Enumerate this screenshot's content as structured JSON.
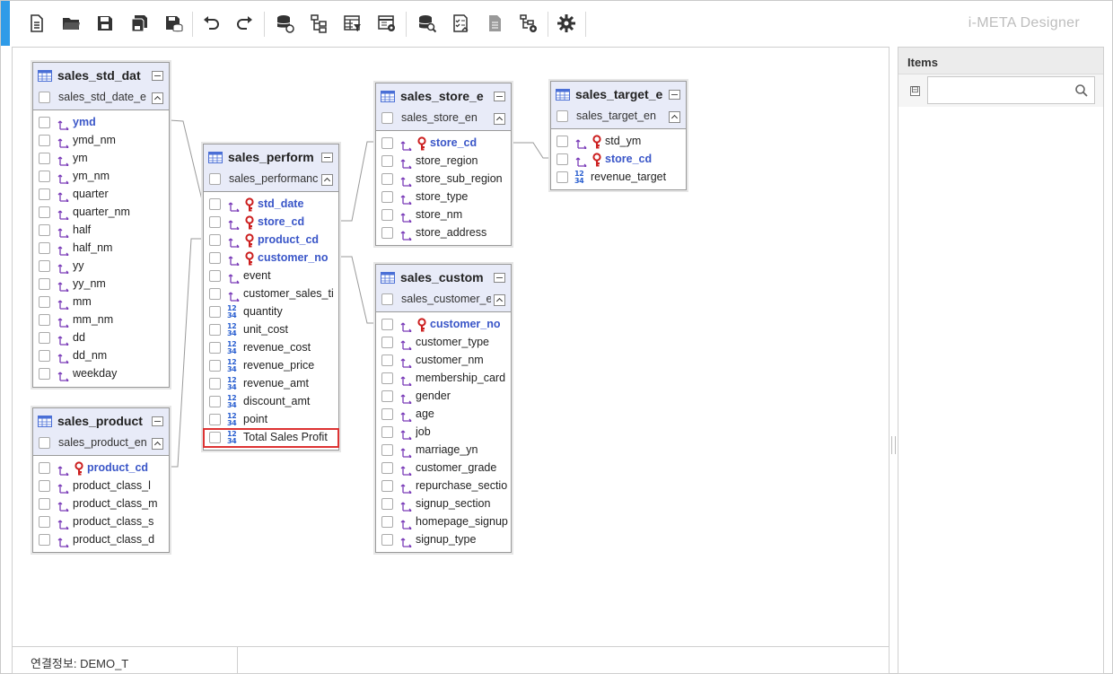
{
  "app": {
    "brand": "i-META Designer"
  },
  "toolbar": {
    "buttons": [
      {
        "name": "new-doc"
      },
      {
        "name": "open"
      },
      {
        "name": "save"
      },
      {
        "name": "save-all"
      },
      {
        "name": "save-db"
      },
      {
        "name": "undo"
      },
      {
        "name": "redo"
      },
      {
        "name": "db-link"
      },
      {
        "name": "tree"
      },
      {
        "name": "table-filter"
      },
      {
        "name": "table-settings"
      },
      {
        "name": "db-search"
      },
      {
        "name": "checklist"
      },
      {
        "name": "document"
      },
      {
        "name": "tree-settings"
      },
      {
        "name": "gear"
      }
    ]
  },
  "status": {
    "connection": "연결정보: DEMO_T"
  },
  "panel": {
    "title": "Items",
    "toggle": "⊟",
    "search_value": ""
  },
  "entities": {
    "std_date": {
      "title": "sales_std_dat",
      "sub": "sales_std_date_e",
      "fields": [
        {
          "name": "ymd",
          "kind": "dim",
          "pk": true
        },
        {
          "name": "ymd_nm",
          "kind": "dim"
        },
        {
          "name": "ym",
          "kind": "dim"
        },
        {
          "name": "ym_nm",
          "kind": "dim"
        },
        {
          "name": "quarter",
          "kind": "dim"
        },
        {
          "name": "quarter_nm",
          "kind": "dim"
        },
        {
          "name": "half",
          "kind": "dim"
        },
        {
          "name": "half_nm",
          "kind": "dim"
        },
        {
          "name": "yy",
          "kind": "dim"
        },
        {
          "name": "yy_nm",
          "kind": "dim"
        },
        {
          "name": "mm",
          "kind": "dim"
        },
        {
          "name": "mm_nm",
          "kind": "dim"
        },
        {
          "name": "dd",
          "kind": "dim"
        },
        {
          "name": "dd_nm",
          "kind": "dim"
        },
        {
          "name": "weekday",
          "kind": "dim"
        }
      ]
    },
    "product": {
      "title": "sales_product",
      "sub": "sales_product_en",
      "fields": [
        {
          "name": "product_cd",
          "kind": "dim",
          "pk": true,
          "key": true
        },
        {
          "name": "product_class_l",
          "kind": "dim"
        },
        {
          "name": "product_class_m",
          "kind": "dim"
        },
        {
          "name": "product_class_s",
          "kind": "dim"
        },
        {
          "name": "product_class_d",
          "kind": "dim"
        }
      ]
    },
    "perform": {
      "title": "sales_perform",
      "sub": "sales_performanc",
      "fields": [
        {
          "name": "std_date",
          "kind": "dim",
          "pk": true,
          "key": true
        },
        {
          "name": "store_cd",
          "kind": "dim",
          "pk": true,
          "key": true
        },
        {
          "name": "product_cd",
          "kind": "dim",
          "pk": true,
          "key": true
        },
        {
          "name": "customer_no",
          "kind": "dim",
          "pk": true,
          "key": true
        },
        {
          "name": "event",
          "kind": "dim"
        },
        {
          "name": "customer_sales_ti",
          "kind": "dim"
        },
        {
          "name": "quantity",
          "kind": "num"
        },
        {
          "name": "unit_cost",
          "kind": "num"
        },
        {
          "name": "revenue_cost",
          "kind": "num"
        },
        {
          "name": "revenue_price",
          "kind": "num"
        },
        {
          "name": "revenue_amt",
          "kind": "num"
        },
        {
          "name": "discount_amt",
          "kind": "num"
        },
        {
          "name": "point",
          "kind": "num"
        },
        {
          "name": "Total Sales Profit",
          "kind": "num",
          "highlight": true
        }
      ]
    },
    "store": {
      "title": "sales_store_e",
      "sub": "sales_store_en",
      "fields": [
        {
          "name": "store_cd",
          "kind": "dim",
          "pk": true,
          "key": true
        },
        {
          "name": "store_region",
          "kind": "dim"
        },
        {
          "name": "store_sub_region",
          "kind": "dim"
        },
        {
          "name": "store_type",
          "kind": "dim"
        },
        {
          "name": "store_nm",
          "kind": "dim"
        },
        {
          "name": "store_address",
          "kind": "dim"
        }
      ]
    },
    "target": {
      "title": "sales_target_e",
      "sub": "sales_target_en",
      "fields": [
        {
          "name": "std_ym",
          "kind": "dim",
          "key": true
        },
        {
          "name": "store_cd",
          "kind": "dim",
          "pk": true,
          "key": true
        },
        {
          "name": "revenue_target",
          "kind": "num"
        }
      ]
    },
    "customer": {
      "title": "sales_custom",
      "sub": "sales_customer_e",
      "fields": [
        {
          "name": "customer_no",
          "kind": "dim",
          "pk": true,
          "key": true
        },
        {
          "name": "customer_type",
          "kind": "dim"
        },
        {
          "name": "customer_nm",
          "kind": "dim"
        },
        {
          "name": "membership_card",
          "kind": "dim"
        },
        {
          "name": "gender",
          "kind": "dim"
        },
        {
          "name": "age",
          "kind": "dim"
        },
        {
          "name": "job",
          "kind": "dim"
        },
        {
          "name": "marriage_yn",
          "kind": "dim"
        },
        {
          "name": "customer_grade",
          "kind": "dim"
        },
        {
          "name": "repurchase_sectio",
          "kind": "dim"
        },
        {
          "name": "signup_section",
          "kind": "dim"
        },
        {
          "name": "homepage_signup",
          "kind": "dim"
        },
        {
          "name": "signup_type",
          "kind": "dim"
        }
      ]
    }
  },
  "colors": {
    "accent": "#2f9be8",
    "pk_text": "#3a56c8",
    "key_icon": "#cc1f1f",
    "dim_icon": "#7a3bb8",
    "num_icon": "#2a5fd0",
    "highlight": "#dd3333",
    "entity_header": "#e8ebf8"
  }
}
